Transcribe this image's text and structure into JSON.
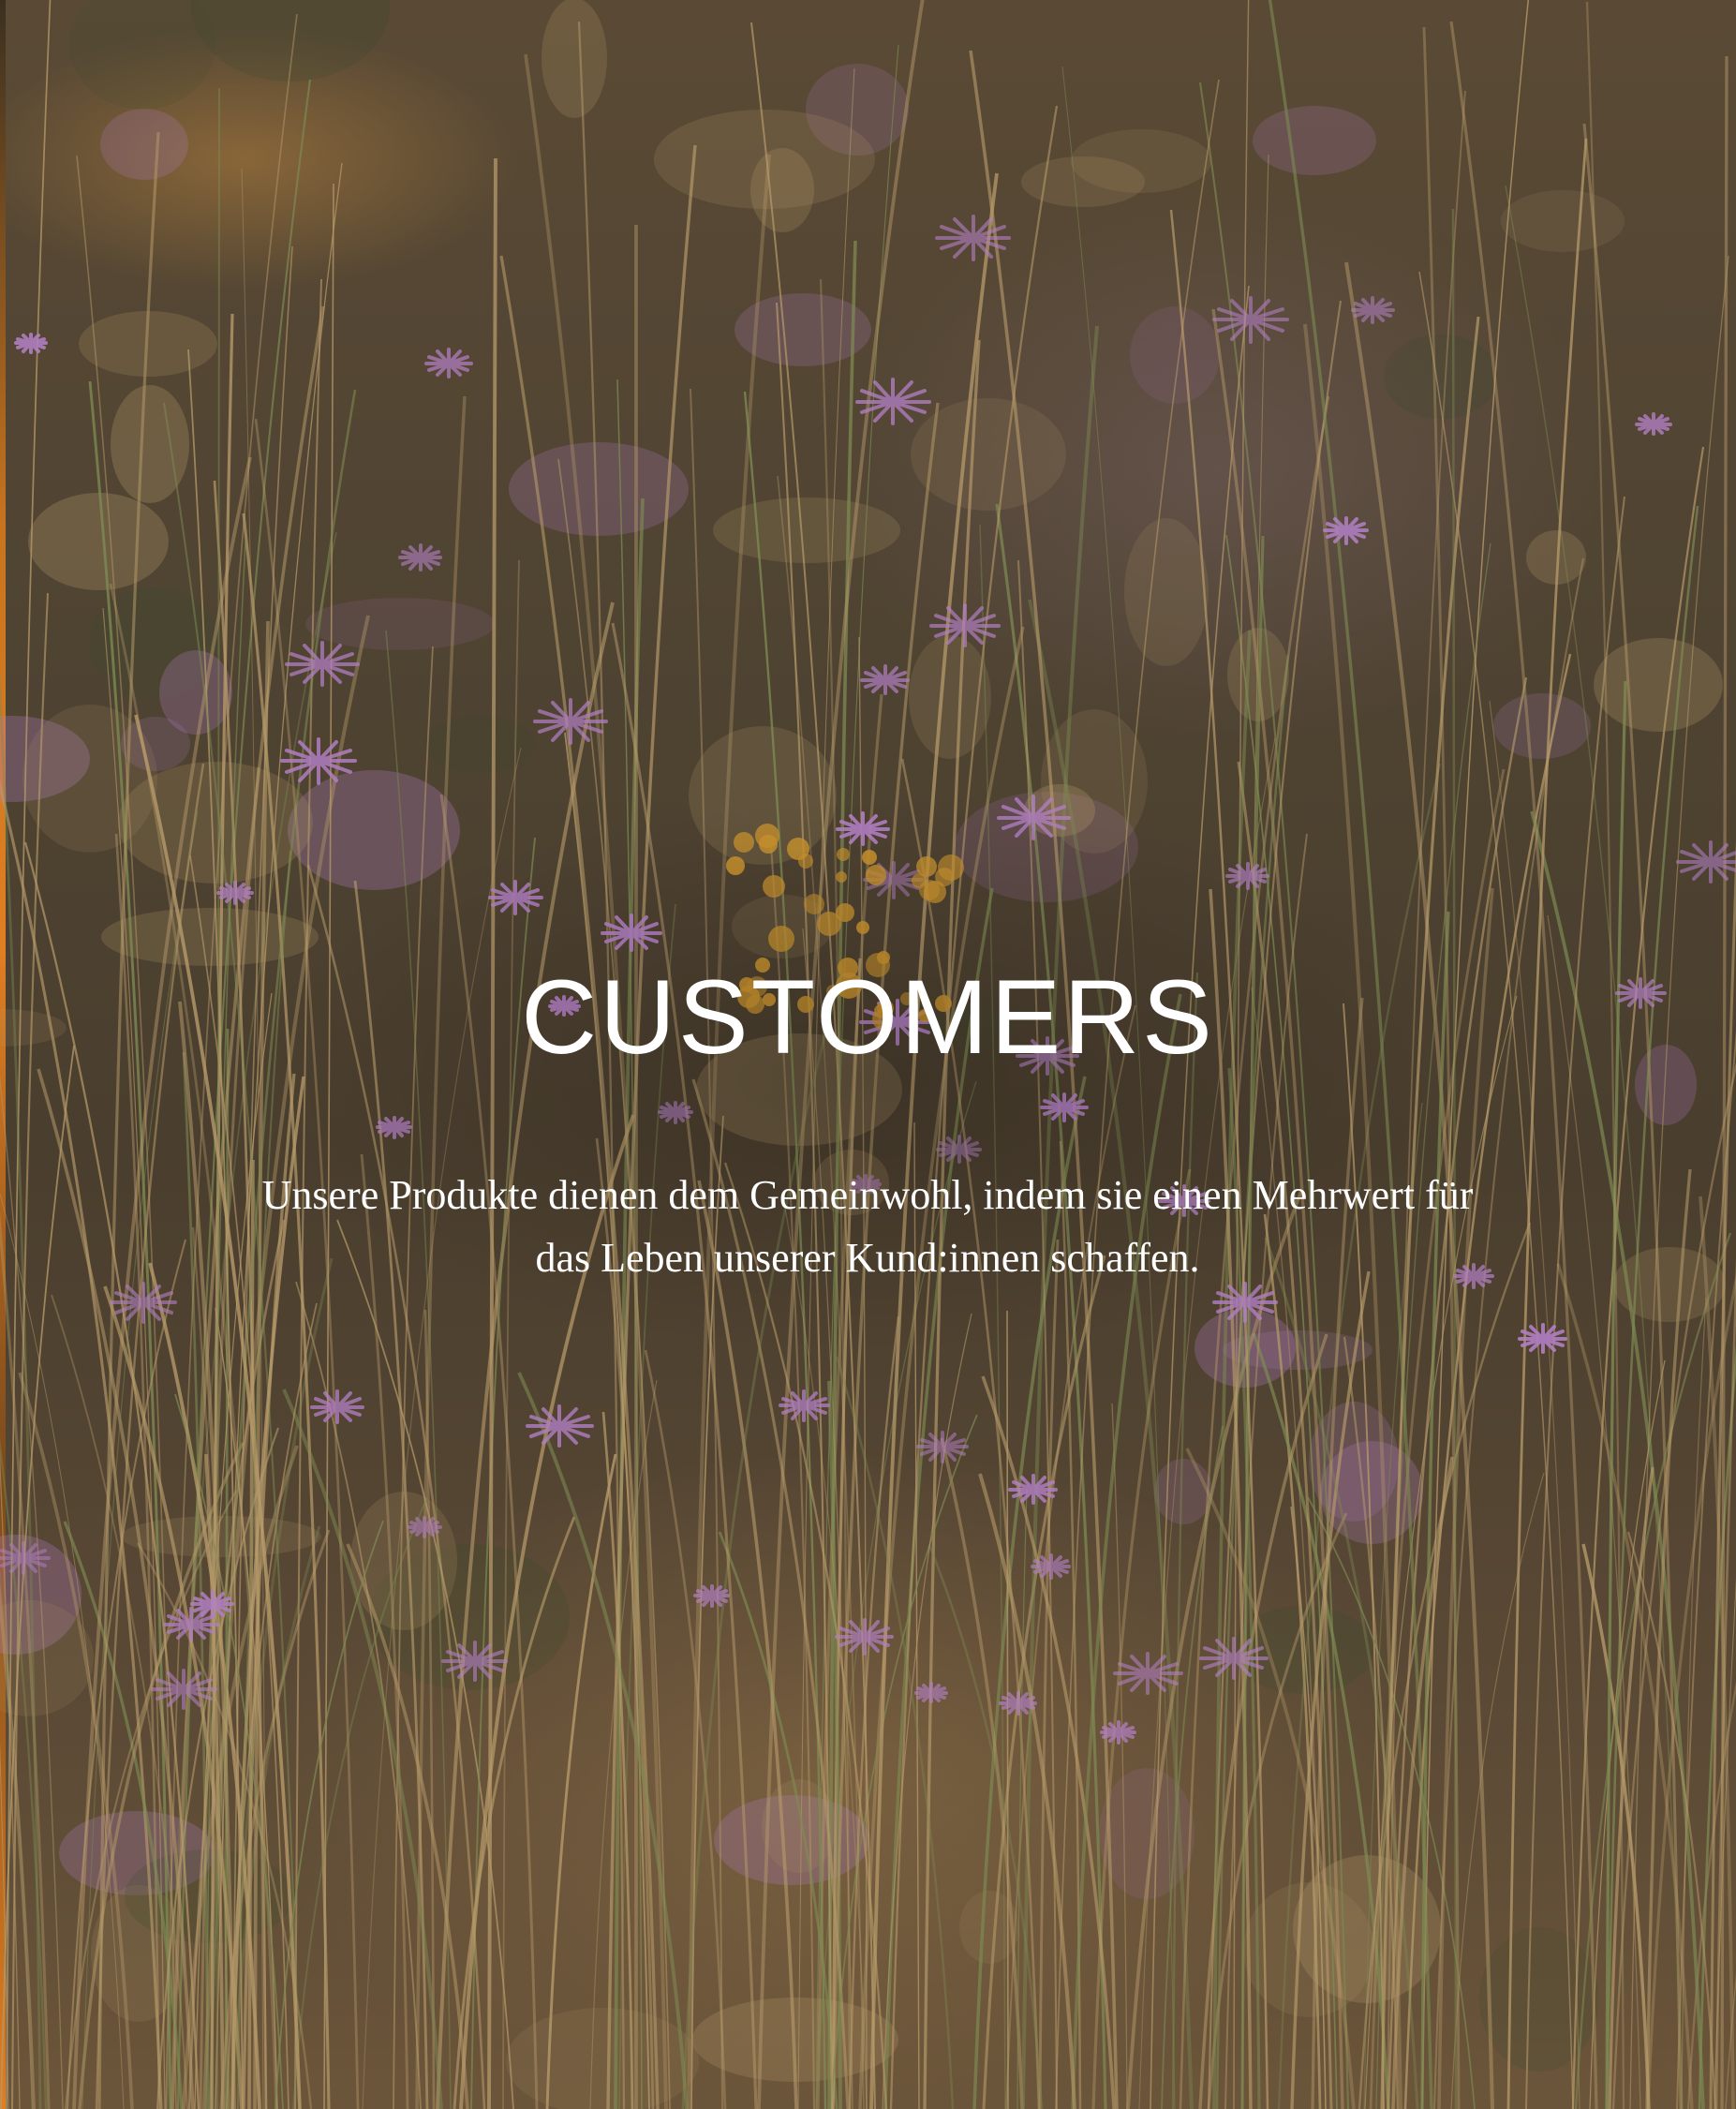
{
  "hero": {
    "title": "CUSTOMERS",
    "text": "Unsere Produkte dienen dem Gemeinwohl, indem sie einen Mehrwert für das Leben unserer Kund:innen schaffen."
  },
  "background": {
    "image": "meadow-wildflowers-photo",
    "colors": {
      "flower": "#b27fc4",
      "grass": "#b69a6a",
      "yarrow": "#c8922e"
    }
  }
}
